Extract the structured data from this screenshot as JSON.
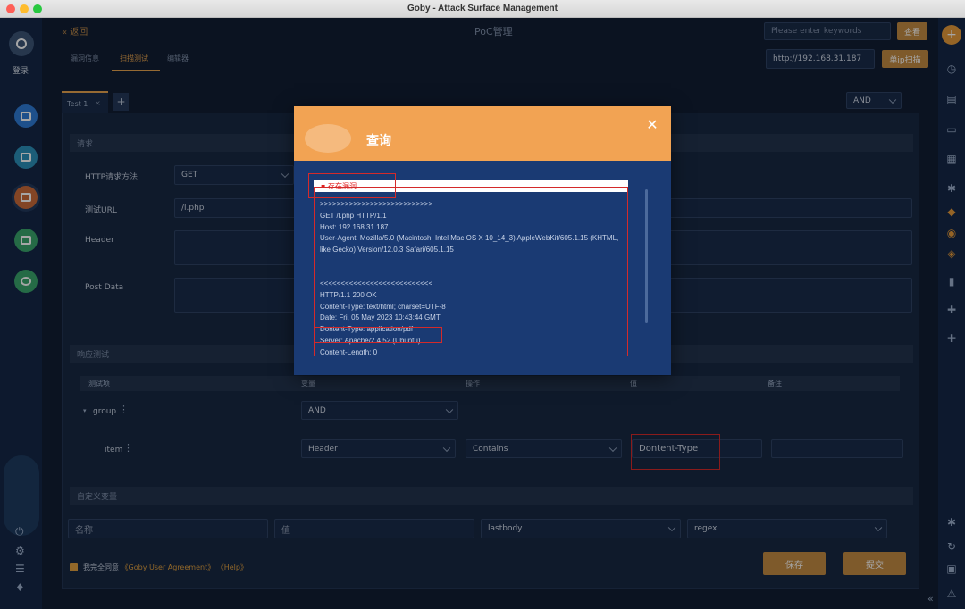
{
  "window": {
    "title": "Goby - Attack Surface Management"
  },
  "left_nav": {
    "login_label": "登录"
  },
  "header": {
    "back_label": "« 返回",
    "page_title": "PoC管理",
    "search_placeholder": "Please enter keywords",
    "search_button": "查看",
    "ip_value": "http://192.168.31.187",
    "single_scan_button": "单ip扫描"
  },
  "tabs": {
    "items": [
      "漏洞信息",
      "扫描测试",
      "编辑器"
    ],
    "active": "扫描测试"
  },
  "test_tabs": {
    "tab_label": "Test 1",
    "close_glyph": "×",
    "add_glyph": "+"
  },
  "logic_select": {
    "value": "AND"
  },
  "request_section": {
    "title": "请求",
    "method_label": "HTTP请求方法",
    "method_value": "GET",
    "url_label": "测试URL",
    "url_value": "/l.php",
    "header_label": "Header",
    "postdata_label": "Post Data"
  },
  "response_section": {
    "title": "响应测试",
    "columns": [
      "测试项",
      "变量",
      "操作",
      "值",
      "备注"
    ],
    "group_label": "group",
    "group_value": "AND",
    "item_label": "item",
    "item_variable": "Header",
    "item_operation": "Contains",
    "item_value": "Dontent-Type"
  },
  "custom_vars": {
    "title": "自定义变量",
    "name_placeholder": "名称",
    "value_placeholder": "值",
    "source_value": "lastbody",
    "type_value": "regex"
  },
  "agreement": {
    "text": "我完全同意",
    "link1": "《Goby User Agreement》",
    "link2": "《Help》"
  },
  "actions": {
    "save": "保存",
    "submit": "提交"
  },
  "modal": {
    "title": "查询",
    "vuln_banner": "存在漏洞",
    "request_lines": [
      ">>>>>>>>>>>>>>>>>>>>>>>>>>>",
      "GET /l.php HTTP/1.1",
      "Host: 192.168.31.187",
      "User-Agent: Mozilla/5.0 (Macintosh; Intel Mac OS X 10_14_3) AppleWebKit/605.1.15 (KHTML, like Gecko) Version/12.0.3 Safari/605.1.15"
    ],
    "response_lines": [
      "<<<<<<<<<<<<<<<<<<<<<<<<<<<",
      "HTTP/1.1 200 OK",
      "Content-Type: text/html; charset=UTF-8",
      "Date: Fri, 05 May 2023 10:43:44 GMT",
      "Dontent-Type: application/pdf",
      "Server: Apache/2.4.52 (Ubuntu)",
      "Content-Length: 0"
    ]
  }
}
